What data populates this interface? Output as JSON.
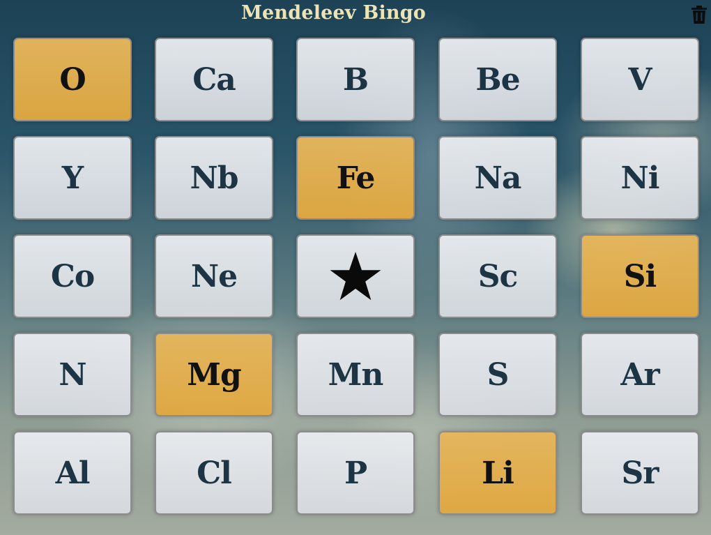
{
  "app": {
    "title": "Mendeleev Bingo",
    "clear_icon": "trash-icon"
  },
  "colors": {
    "title": "#ede3b4",
    "marked_tile": "#e3b159",
    "unmarked_tile": "#e1e4e8",
    "symbol_text": "#1c3444"
  },
  "board": {
    "rows": 5,
    "cols": 5,
    "free_space_icon": "star-icon",
    "cells": [
      {
        "symbol": "O",
        "marked": true
      },
      {
        "symbol": "Ca",
        "marked": false
      },
      {
        "symbol": "B",
        "marked": false
      },
      {
        "symbol": "Be",
        "marked": false
      },
      {
        "symbol": "V",
        "marked": false
      },
      {
        "symbol": "Y",
        "marked": false
      },
      {
        "symbol": "Nb",
        "marked": false
      },
      {
        "symbol": "Fe",
        "marked": true
      },
      {
        "symbol": "Na",
        "marked": false
      },
      {
        "symbol": "Ni",
        "marked": false
      },
      {
        "symbol": "Co",
        "marked": false
      },
      {
        "symbol": "Ne",
        "marked": false
      },
      {
        "symbol": "",
        "marked": false,
        "free": true
      },
      {
        "symbol": "Sc",
        "marked": false
      },
      {
        "symbol": "Si",
        "marked": true
      },
      {
        "symbol": "N",
        "marked": false
      },
      {
        "symbol": "Mg",
        "marked": true
      },
      {
        "symbol": "Mn",
        "marked": false
      },
      {
        "symbol": "S",
        "marked": false
      },
      {
        "symbol": "Ar",
        "marked": false
      },
      {
        "symbol": "Al",
        "marked": false
      },
      {
        "symbol": "Cl",
        "marked": false
      },
      {
        "symbol": "P",
        "marked": false
      },
      {
        "symbol": "Li",
        "marked": true
      },
      {
        "symbol": "Sr",
        "marked": false
      }
    ]
  }
}
